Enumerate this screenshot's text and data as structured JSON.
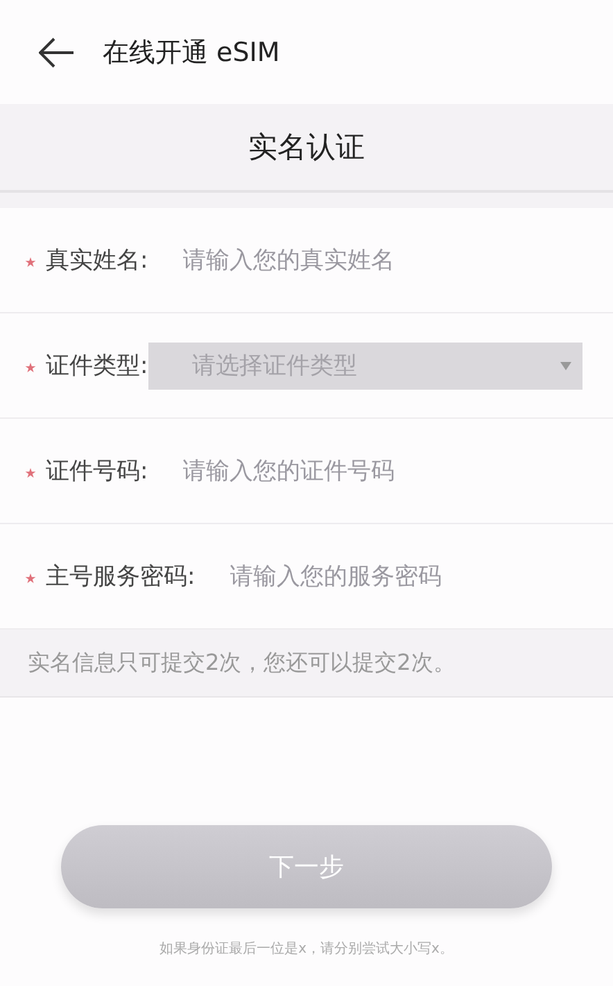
{
  "header": {
    "title": "在线开通 eSIM"
  },
  "section_title": "实名认证",
  "fields": [
    {
      "kind": "input",
      "label": "真实姓名:",
      "required": true,
      "placeholder": "请输入您的真实姓名"
    },
    {
      "kind": "select",
      "label": "证件类型:",
      "required": true,
      "placeholder": "请选择证件类型"
    },
    {
      "kind": "input",
      "label": "证件号码:",
      "required": true,
      "placeholder": "请输入您的证件号码"
    },
    {
      "kind": "input",
      "label": "主号服务密码:",
      "required": true,
      "placeholder": "请输入您的服务密码"
    }
  ],
  "notice": "实名信息只可提交2次，您还可以提交2次。",
  "next_button": {
    "label": "下一步",
    "disabled": true
  },
  "footnote": "如果身份证最后一位是x，请分别尝试大小写x。"
}
